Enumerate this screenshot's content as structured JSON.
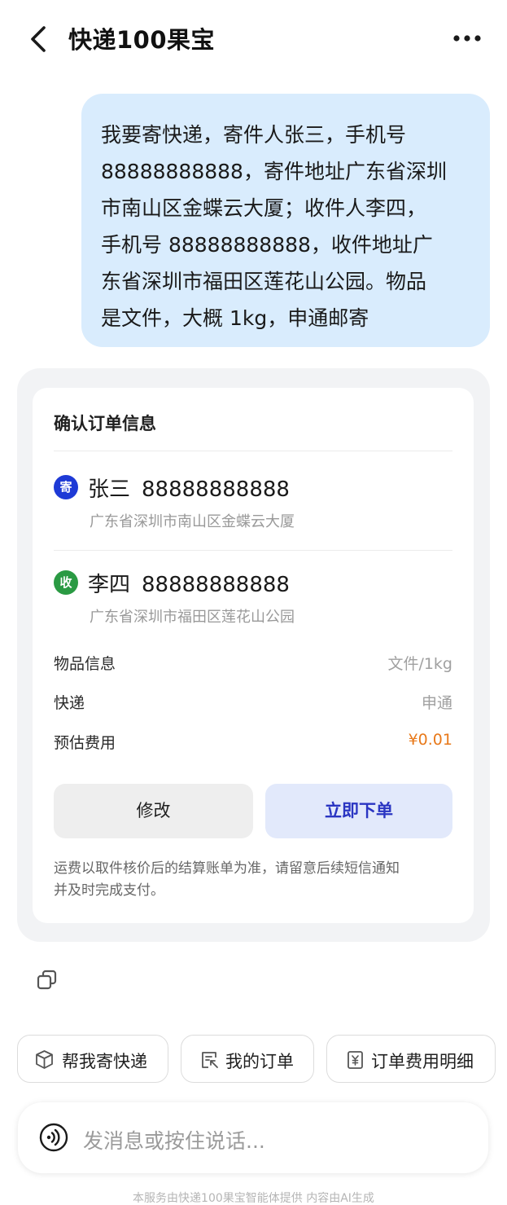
{
  "header": {
    "title": "快递100果宝",
    "back_icon": "chevron-left-icon",
    "more_icon": "more-horizontal-icon"
  },
  "user_message": {
    "lines": [
      "我要寄快递，寄件人张三，手机号",
      "88888888888，寄件地址广东省深圳",
      "市南山区金蝶云大厦；收件人李四，",
      "手机号 88888888888，收件地址广",
      "东省深圳市福田区莲花山公园。物品",
      "是文件，大概 1kg，申通邮寄"
    ]
  },
  "order_card": {
    "title": "确认订单信息",
    "sender": {
      "badge": "寄",
      "name": "张三",
      "phone": "88888888888",
      "address": "广东省深圳市南山区金蝶云大厦"
    },
    "receiver": {
      "badge": "收",
      "name": "李四",
      "phone": "88888888888",
      "address": "广东省深圳市福田区莲花山公园"
    },
    "info": {
      "item_label": "物品信息",
      "item_value": "文件/1kg",
      "courier_label": "快递",
      "courier_value": "申通",
      "fee_label": "预估费用",
      "fee_value": "¥0.01"
    },
    "modify_label": "修改",
    "order_label": "立即下单",
    "notice_lines": [
      "运费以取件核价后的结算账单为准，请留意后续短信通知",
      "并及时完成支付。"
    ]
  },
  "quick_actions": [
    {
      "label": "帮我寄快递",
      "icon": "package-icon"
    },
    {
      "label": "我的订单",
      "icon": "order-list-icon"
    },
    {
      "label": "订单费用明细",
      "icon": "receipt-yuan-icon"
    }
  ],
  "input": {
    "placeholder": "发消息或按住说话..."
  },
  "footer": "本服务由快递100果宝智能体提供 内容由AI生成",
  "colors": {
    "user_bubble": "#d9ecfd",
    "sender_badge": "#1e3ad6",
    "receiver_badge": "#2a9a43",
    "fee": "#e8791a",
    "primary_button_text": "#2a35c2"
  }
}
